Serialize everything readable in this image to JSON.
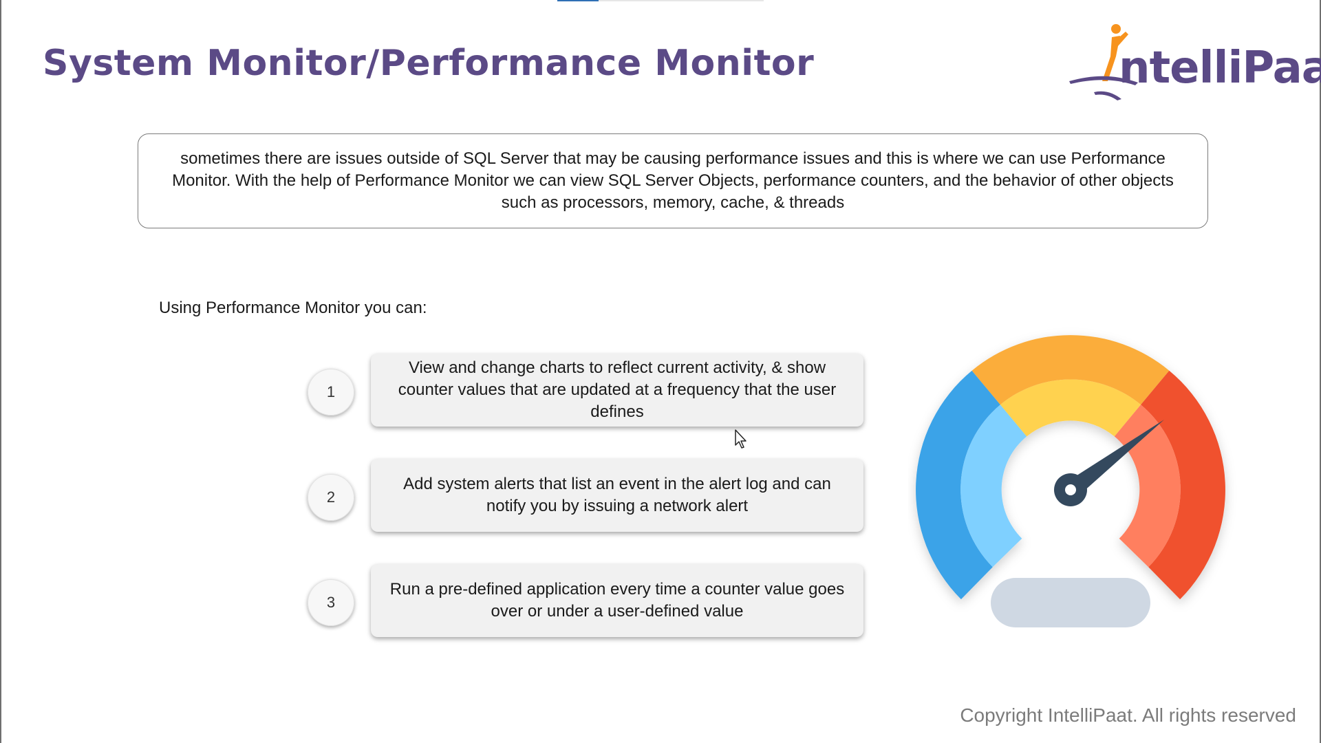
{
  "slide": {
    "title": "System Monitor/Performance Monitor",
    "logo": {
      "text": "ntelliPaat",
      "brand": "IntelliPaat",
      "accent": "#f7931e",
      "primary": "#5b4a86"
    },
    "description": "sometimes there are issues outside of SQL Server that may be causing performance issues and this is where we can use Performance Monitor. With the help of Performance Monitor we can view SQL Server Objects, performance counters, and the behavior of other objects such as processors, memory, cache, & threads",
    "subheading": "Using Performance Monitor you can:",
    "items": [
      {
        "number": "1",
        "text": "View and change charts to reflect current activity, & show counter values that are updated at a frequency that the user defines"
      },
      {
        "number": "2",
        "text": "Add system alerts that list an event in the alert log and can notify you by issuing a network alert"
      },
      {
        "number": "3",
        "text": "Run a pre-defined application every time a counter value goes over or under a user-defined value"
      }
    ],
    "gauge": {
      "icon": "speedometer-icon",
      "colors": {
        "blue": "#3ba3e8",
        "light_blue": "#7fd0ff",
        "orange": "#fbad3b",
        "yellow": "#ffd24f",
        "red": "#f0512f",
        "light_red": "#ff7f5e",
        "needle": "#34495e",
        "base": "#cfd8e3"
      }
    },
    "copyright": "Copyright IntelliPaat. All rights reserved"
  }
}
